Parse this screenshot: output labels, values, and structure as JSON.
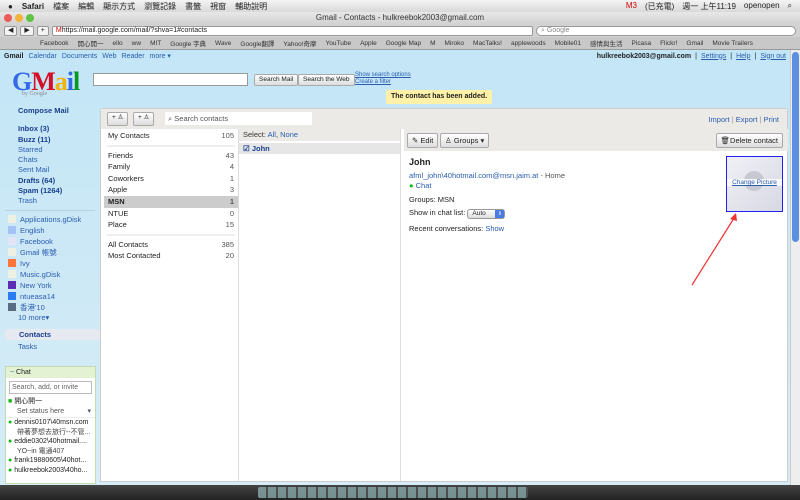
{
  "menubar": {
    "app": "Safari",
    "items": [
      "檔案",
      "編輯",
      "顯示方式",
      "瀏覽記錄",
      "書籤",
      "視窗",
      "輔助說明"
    ],
    "status": [
      "M3",
      "(已充電)",
      "週一 上午11:19",
      "openopen"
    ]
  },
  "window": {
    "title": "Gmail - Contacts - hulkreebok2003@gmail.com",
    "url": "https://mail.google.com/mail/?shva=1#contacts",
    "search_placeholder": "Google"
  },
  "bookmarks": [
    "Facebook",
    "開心開一",
    "ello",
    "ww",
    "MIT",
    "Google 字典",
    "Wave",
    "Google翻譯",
    "Yahoo!奇摩",
    "YouTube",
    "Apple",
    "Google Map",
    "M",
    "Miroko",
    "MacTalks!",
    "applewoods",
    "Mobile01",
    "感情與生活",
    "Picasa",
    "Flickr!",
    "Gmail",
    "Movie Trailers"
  ],
  "gbar": {
    "links": [
      "Gmail",
      "Calendar",
      "Documents",
      "Web",
      "Reader",
      "more ▾"
    ],
    "email": "hulkreebok2003@gmail.com",
    "right": [
      "Settings",
      "Help",
      "Sign out"
    ]
  },
  "header": {
    "logo": "Gmail",
    "logo_sub": "by Google",
    "search_mail": "Search Mail",
    "search_web": "Search the Web",
    "show_options": "Show search options",
    "create_filter": "Create a filter",
    "notice": "The contact has been added."
  },
  "sidebar": {
    "compose": "Compose Mail",
    "nav": [
      {
        "label": "Inbox (3)",
        "bold": true
      },
      {
        "label": "Buzz (11)",
        "bold": true
      },
      {
        "label": "Starred",
        "bold": false
      },
      {
        "label": "Chats",
        "bold": false
      },
      {
        "label": "Sent Mail",
        "bold": false
      },
      {
        "label": "Drafts (64)",
        "bold": true
      },
      {
        "label": "Spam (1264)",
        "bold": true
      },
      {
        "label": "Trash",
        "bold": false
      }
    ],
    "labels": [
      {
        "name": "Applications.gDisk",
        "color": "#eef0e4"
      },
      {
        "name": "English",
        "color": "#a4c2f4"
      },
      {
        "name": "Facebook",
        "color": "#e4e4f8"
      },
      {
        "name": "Gmail 帳號",
        "color": "#eef0e4"
      },
      {
        "name": "Ivy",
        "color": "#ff7537"
      },
      {
        "name": "Music.gDisk",
        "color": "#eef0e4"
      },
      {
        "name": "New York",
        "color": "#5b2db5"
      },
      {
        "name": "ntueasa14",
        "color": "#2a7cf0"
      },
      {
        "name": "香港'10",
        "color": "#596b85"
      }
    ],
    "more": "10 more▾",
    "contacts": "Contacts",
    "tasks": "Tasks"
  },
  "chat": {
    "title": "Chat",
    "search_placeholder": "Search, add, or invite",
    "me": "開心開一",
    "status": "Set status here",
    "buddies": [
      {
        "name": "dennis0107\\40msn.com",
        "msg": "帶著夢想去旅行--不管..."
      },
      {
        "name": "eddie0302\\40hotmail....",
        "msg": "YO~in 電通407"
      },
      {
        "name": "frank19880605\\40hot...",
        "msg": ""
      },
      {
        "name": "hulkreebok2003\\40ho...",
        "msg": ""
      }
    ]
  },
  "contacts": {
    "search_placeholder": "Search contacts",
    "import": "Import",
    "export": "Export",
    "print": "Print",
    "groups": [
      {
        "name": "My Contacts",
        "count": "105"
      },
      {
        "name": "Friends",
        "count": "43"
      },
      {
        "name": "Family",
        "count": "4"
      },
      {
        "name": "Coworkers",
        "count": "1"
      },
      {
        "name": "Apple",
        "count": "3"
      },
      {
        "name": "MSN",
        "count": "1"
      },
      {
        "name": "NTUE",
        "count": "0"
      },
      {
        "name": "Place",
        "count": "15"
      },
      {
        "name": "All Contacts",
        "count": "385"
      },
      {
        "name": "Most Contacted",
        "count": "20"
      }
    ],
    "select_label": "Select:",
    "select_all": "All",
    "select_none": "None",
    "list": [
      "John"
    ],
    "edit": "Edit",
    "groups_btn": "Groups",
    "delete": "Delete contact",
    "detail": {
      "name": "John",
      "email": "afml_john\\40hotmail.com@msn.jaim.at",
      "email_type": "- Home",
      "chat": "Chat",
      "groups": "Groups: MSN",
      "show_chat": "Show in chat list:",
      "chat_option": "Auto",
      "recent": "Recent conversations:",
      "show": "Show",
      "change_picture": "Change Picture"
    }
  }
}
